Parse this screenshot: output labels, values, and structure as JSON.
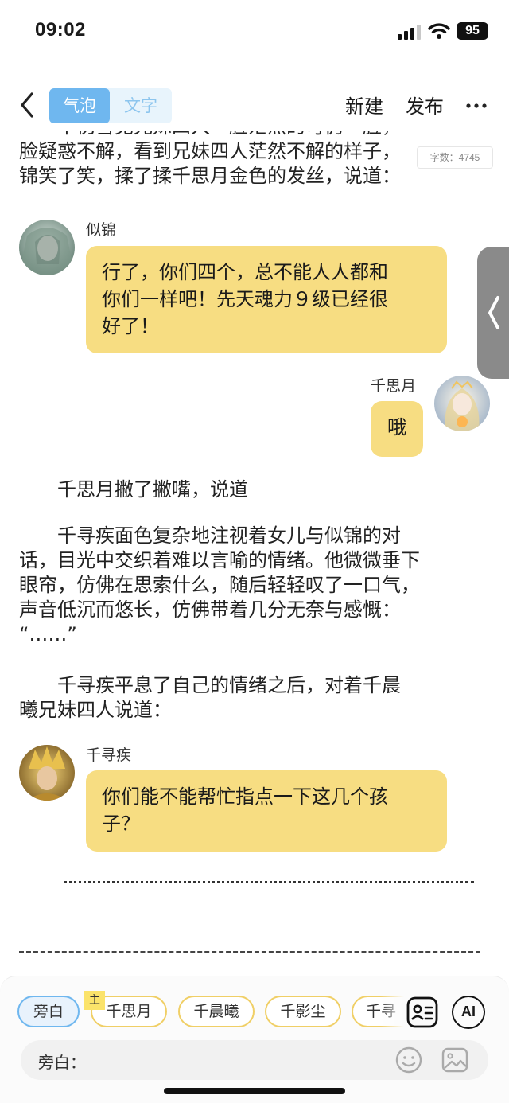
{
  "status_bar": {
    "time": "09:02",
    "battery": "95"
  },
  "nav": {
    "mode_bubble": "气泡",
    "mode_text": "文字",
    "new_label": "新建",
    "publish_label": "发布"
  },
  "word_count": "字数：4745",
  "paragraphs": {
    "p0_line0": "千仞雪见兄妹四人一脸茫然的可仍一脸，一",
    "p0_line1": "脸疑惑不解，看到兄妹四人茫然不解的样子，",
    "p0_line2": "锦笑了笑，揉了揉千思月金色的发丝，说道：",
    "p1": "千思月撇了撇嘴，说道",
    "p2_line0": "千寻疾面色复杂地注视着女儿与似锦的对",
    "p2_line1": "话，目光中交织着难以言喻的情绪。他微微垂下",
    "p2_line2": "眼帘，仿佛在思索什么，随后轻轻叹了一口气，",
    "p2_line3": "声音低沉而悠长，仿佛带着几分无奈与感慨：",
    "p2_line4": "“……”",
    "p3_line0": "千寻疾平息了自己的情绪之后，对着千晨",
    "p3_line1": "曦兄妹四人说道："
  },
  "messages": {
    "m1": {
      "speaker": "似锦",
      "line0": "行了，你们四个，总不能人人都和",
      "line1": "你们一样吧！先天魂力９级已经很",
      "line2": "好了！"
    },
    "m2": {
      "speaker": "千思月",
      "text": "哦"
    },
    "m3": {
      "speaker": "千寻疾",
      "line0": "你们能不能帮忙指点一下这几个孩",
      "line1": "子？"
    }
  },
  "characters": {
    "narrator": "旁白",
    "badge": "主",
    "c1": "千思月",
    "c2": "千晨曦",
    "c3": "千影尘",
    "c4": "千寻"
  },
  "input": {
    "label": "旁白："
  },
  "ai_label": "AI",
  "colors": {
    "accent_blue": "#6fb7ef",
    "bubble_yellow": "#f7dd82",
    "chip_border": "#f0cf66"
  }
}
